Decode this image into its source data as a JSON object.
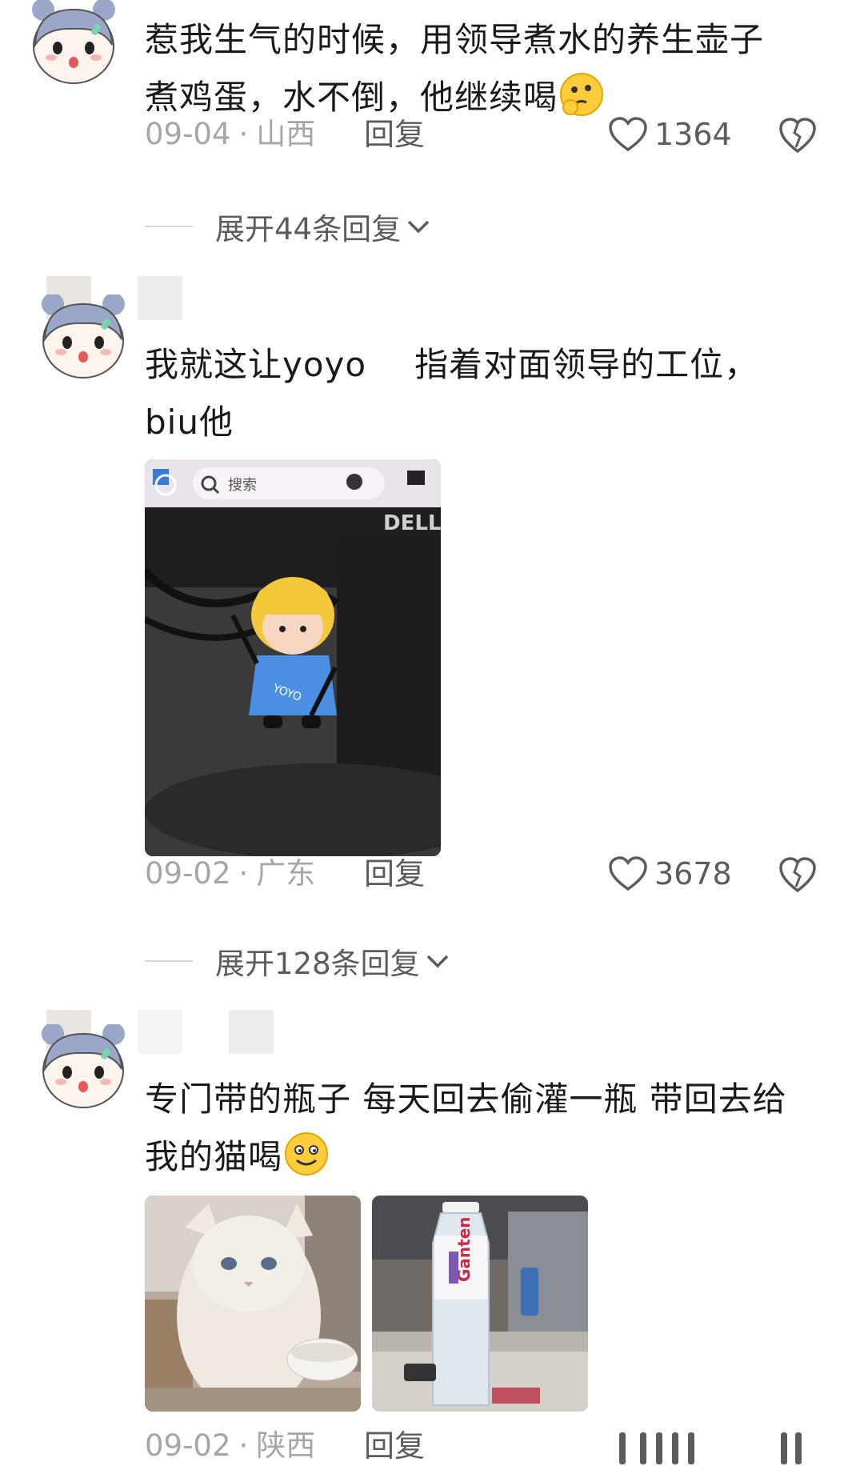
{
  "comments": [
    {
      "text_line1": "惹我生气的时候，用领导煮水的养生壶子",
      "text_line2": "煮鸡蛋，水不倒，他继续喝",
      "emoji": "thinking-emoji",
      "date": "09-04",
      "location": "山西",
      "reply_label": "回复",
      "likes": "1364",
      "expand_label": "展开44条回复"
    },
    {
      "text_line1_a": "我就这让yoyo",
      "text_line1_b": "指着对面领导的工位，",
      "text_line2": "biu他",
      "date": "09-02",
      "location": "广东",
      "reply_label": "回复",
      "likes": "3678",
      "expand_label": "展开128条回复",
      "photo": {
        "search_placeholder": "搜索",
        "brand": "DELL",
        "figure_label": "YOYO"
      }
    },
    {
      "text_line1": "专门带的瓶子 每天回去偷灌一瓶 带回去给",
      "text_line2": "我的猫喝",
      "emoji": "smile-emoji",
      "date": "09-02",
      "location": "陕西",
      "reply_label": "回复",
      "photos": [
        "cat-photo",
        "water-bottle-photo"
      ],
      "bottle_brand": "Ganten"
    }
  ],
  "colors": {
    "text": "#1a1a1a",
    "meta": "#a6a6a6",
    "action": "#5c5c5c",
    "avatar_hair": "#9aa7c9"
  }
}
